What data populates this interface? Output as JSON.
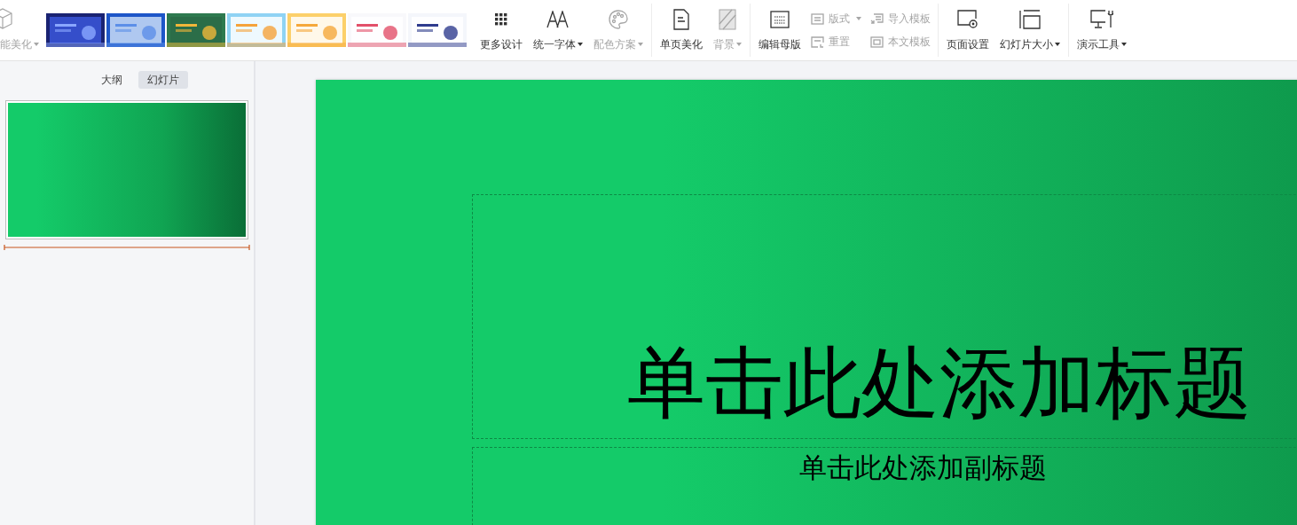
{
  "toolbar": {
    "partial_item": {
      "label": "能美化",
      "disabled": true,
      "dropdown": true
    },
    "templates": [
      {
        "kind": "picture"
      },
      {
        "kind": "picture"
      },
      {
        "kind": "picture"
      },
      {
        "kind": "picture"
      },
      {
        "kind": "picture"
      },
      {
        "kind": "picture"
      },
      {
        "kind": "picture"
      }
    ],
    "groups": [
      [
        {
          "kind": "big",
          "label": "更多设计",
          "disabled": false,
          "dropdown": false
        },
        {
          "kind": "big",
          "label": "统一字体",
          "disabled": false,
          "dropdown": true
        },
        {
          "kind": "big",
          "label": "配色方案",
          "disabled": true,
          "dropdown": true
        }
      ],
      [
        {
          "kind": "big",
          "label": "单页美化",
          "disabled": false,
          "dropdown": false
        },
        {
          "kind": "big",
          "label": "背景",
          "disabled": true,
          "dropdown": true
        }
      ],
      [
        {
          "kind": "big",
          "label": "编辑母版",
          "disabled": false,
          "dropdown": false
        },
        {
          "kind": "stack",
          "items": [
            {
              "label": "版式",
              "disabled": true,
              "dropdown": true
            },
            {
              "label": "重置",
              "disabled": true,
              "dropdown": false
            }
          ]
        },
        {
          "kind": "stack",
          "items": [
            {
              "label": "导入模板",
              "disabled": true,
              "dropdown": false
            },
            {
              "label": "本文模板",
              "disabled": true,
              "dropdown": false
            }
          ]
        }
      ],
      [
        {
          "kind": "big",
          "label": "页面设置",
          "disabled": false,
          "dropdown": false
        },
        {
          "kind": "big",
          "label": "幻灯片大小",
          "disabled": false,
          "dropdown": true
        }
      ],
      [
        {
          "kind": "big",
          "label": "演示工具",
          "disabled": false,
          "dropdown": true
        }
      ]
    ]
  },
  "panel": {
    "tabs": [
      {
        "label": "大纲",
        "selected": false
      },
      {
        "label": "幻灯片",
        "selected": true
      }
    ],
    "slides": [
      {
        "selected": true
      }
    ]
  },
  "slide": {
    "title": "单击此处添加标题",
    "subtitle": "单击此处添加副标题"
  }
}
